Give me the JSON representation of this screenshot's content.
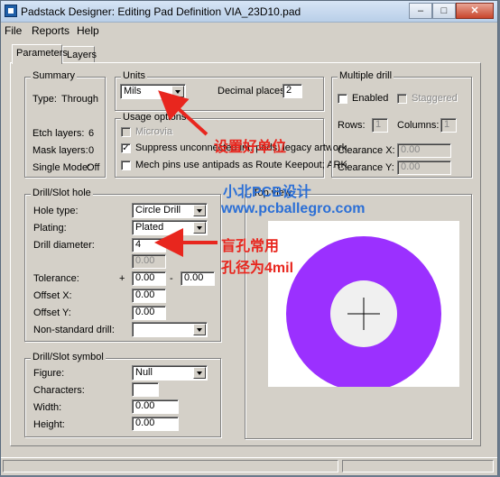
{
  "window": {
    "title": "Padstack Designer: Editing Pad Definition VIA_23D10.pad",
    "minimize_label": "–",
    "maximize_label": "□",
    "close_label": "✕"
  },
  "menu": [
    {
      "label": "File"
    },
    {
      "label": "Reports"
    },
    {
      "label": "Help"
    }
  ],
  "tabs": [
    {
      "label": "Parameters",
      "active": true
    },
    {
      "label": "Layers",
      "active": false
    }
  ],
  "summary": {
    "title": "Summary",
    "type_label": "Type:",
    "type_value": "Through",
    "etch_label": "Etch layers:",
    "etch_value": "6",
    "mask_label": "Mask layers:",
    "mask_value": "0",
    "single_label": "Single Mode:",
    "single_value": "Off"
  },
  "units": {
    "title": "Units",
    "value": "Mils",
    "decimal_label": "Decimal places:",
    "decimal_value": "2"
  },
  "usage": {
    "title": "Usage options",
    "options": [
      {
        "label": "Microvia",
        "checked": false,
        "enabled": false
      },
      {
        "label": "Suppress unconnected int. pads; legacy artwork",
        "checked": true,
        "enabled": true
      },
      {
        "label": "Mech pins use antipads as Route Keepout; ARK",
        "checked": false,
        "enabled": true
      }
    ]
  },
  "multiple_drill": {
    "title": "Multiple drill",
    "enabled_label": "Enabled",
    "staggered_label": "Staggered",
    "rows_label": "Rows:",
    "rows_value": "1",
    "columns_label": "Columns:",
    "columns_value": "1",
    "clearance_x_label": "Clearance X:",
    "clearance_x_value": "0.00",
    "clearance_y_label": "Clearance Y:",
    "clearance_y_value": "0.00"
  },
  "drill_hole": {
    "title": "Drill/Slot hole",
    "hole_type_label": "Hole type:",
    "hole_type_value": "Circle Drill",
    "plating_label": "Plating:",
    "plating_value": "Plated",
    "diameter_label": "Drill diameter:",
    "diameter_value": "4",
    "diameter_secondary": "0.00",
    "tolerance_label": "Tolerance:",
    "tolerance_plus": "+",
    "tolerance_plus_value": "0.00",
    "tolerance_minus": "-",
    "tolerance_minus_value": "0.00",
    "offset_x_label": "Offset X:",
    "offset_x_value": "0.00",
    "offset_y_label": "Offset Y:",
    "offset_y_value": "0.00",
    "nonstandard_label": "Non-standard drill:",
    "nonstandard_value": ""
  },
  "drill_symbol": {
    "title": "Drill/Slot symbol",
    "figure_label": "Figure:",
    "figure_value": "Null",
    "characters_label": "Characters:",
    "characters_value": "",
    "width_label": "Width:",
    "width_value": "0.00",
    "height_label": "Height:",
    "height_value": "0.00"
  },
  "top_view": {
    "title": "Top view",
    "pad_color": "#9b30ff",
    "hole_color": "#f0f0f0"
  },
  "annotations": {
    "units_note": "设置好单位",
    "watermark_1": "小北PCB设计",
    "watermark_2": "www.pcballegro.com",
    "drill_note_1": "盲孔常用",
    "drill_note_2": "孔径为4mil",
    "arrow_color": "#e8261e"
  }
}
